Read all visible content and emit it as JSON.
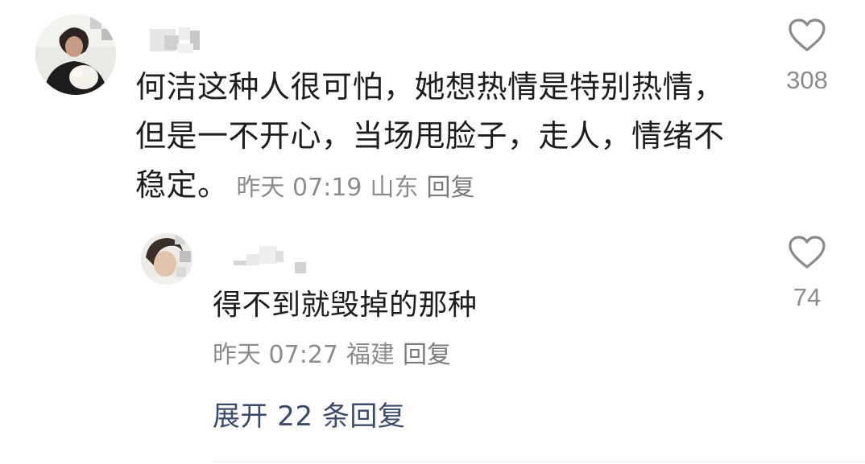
{
  "comment": {
    "text_lines": [
      "何洁这种人很可怕，她想热情是特别热情，",
      "但是一不开心，当场甩脸子，走人，情绪不",
      "稳定。"
    ],
    "time": "昨天 07:19",
    "location": "山东",
    "reply_label": "回复",
    "likes": "308"
  },
  "reply": {
    "text": "得不到就毁掉的那种",
    "time": "昨天 07:27",
    "location": "福建",
    "reply_label": "回复",
    "likes": "74"
  },
  "expand_replies_label": "展开 22 条回复",
  "icons": {
    "like": "heart-outline-icon"
  },
  "colors": {
    "text": "#1e1e1e",
    "meta": "#8c8c8c",
    "link": "#3a4a6b"
  }
}
